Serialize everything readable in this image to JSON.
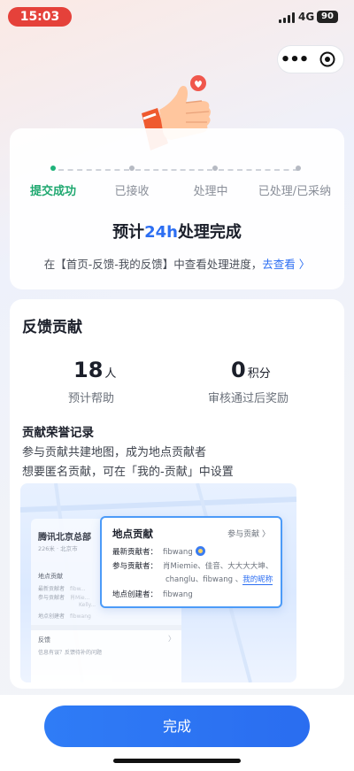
{
  "status_bar": {
    "time": "15:03",
    "network": "4G",
    "battery": "90"
  },
  "steps": [
    {
      "label": "提交成功",
      "active": true
    },
    {
      "label": "已接收",
      "active": false
    },
    {
      "label": "处理中",
      "active": false
    },
    {
      "label": "已处理/已采纳",
      "active": false
    }
  ],
  "status_card": {
    "headline_prefix": "预计",
    "headline_highlight": "24h",
    "headline_suffix": "处理完成",
    "subline_text": "在【首页-反馈-我的反馈】中查看处理进度，",
    "subline_link": "去查看 〉"
  },
  "contribution": {
    "title": "反馈贡献",
    "stats": [
      {
        "value": "18",
        "unit": "人",
        "label": "预计帮助"
      },
      {
        "value": "0",
        "unit": "积分",
        "label": "审核通过后奖励"
      }
    ],
    "honor_title": "贡献荣誉记录",
    "honor_desc": [
      "参与贡献共建地图，成为地点贡献者",
      "想要匿名贡献，可在「我的-贡献」中设置"
    ]
  },
  "illustration": {
    "mini_title": "腾讯北京总部",
    "mini_sub": "226米 · 北京市",
    "mini_section": "地点贡献",
    "mini_rows": [
      {
        "k": "最新贡献者",
        "v": "fibw..."
      },
      {
        "k": "参与贡献者",
        "v": "肖Mie..."
      },
      {
        "k": "",
        "v": "Kelly..."
      },
      {
        "k": "地点创建者",
        "v": "fibwang"
      }
    ],
    "mini_feed_title": "反馈",
    "mini_feed_sub": "信息有误？反馈待补的问题",
    "popup": {
      "title": "地点贡献",
      "link": "参与贡献 〉",
      "latest_key": "最新贡献者：",
      "latest_value": "fibwang",
      "participants_key": "参与贡献者：",
      "participants_line1": "肖Miemie、佳音、大大大大坤、",
      "participants_line2": "changlu、fibwang 、",
      "participants_me": "我的昵称",
      "creator_key": "地点创建者：",
      "creator_value": "fibwang"
    }
  },
  "footer": {
    "done_label": "完成"
  },
  "colors": {
    "accent": "#2c6ef2",
    "success": "#1fa870",
    "time_pill": "#e5413a"
  }
}
